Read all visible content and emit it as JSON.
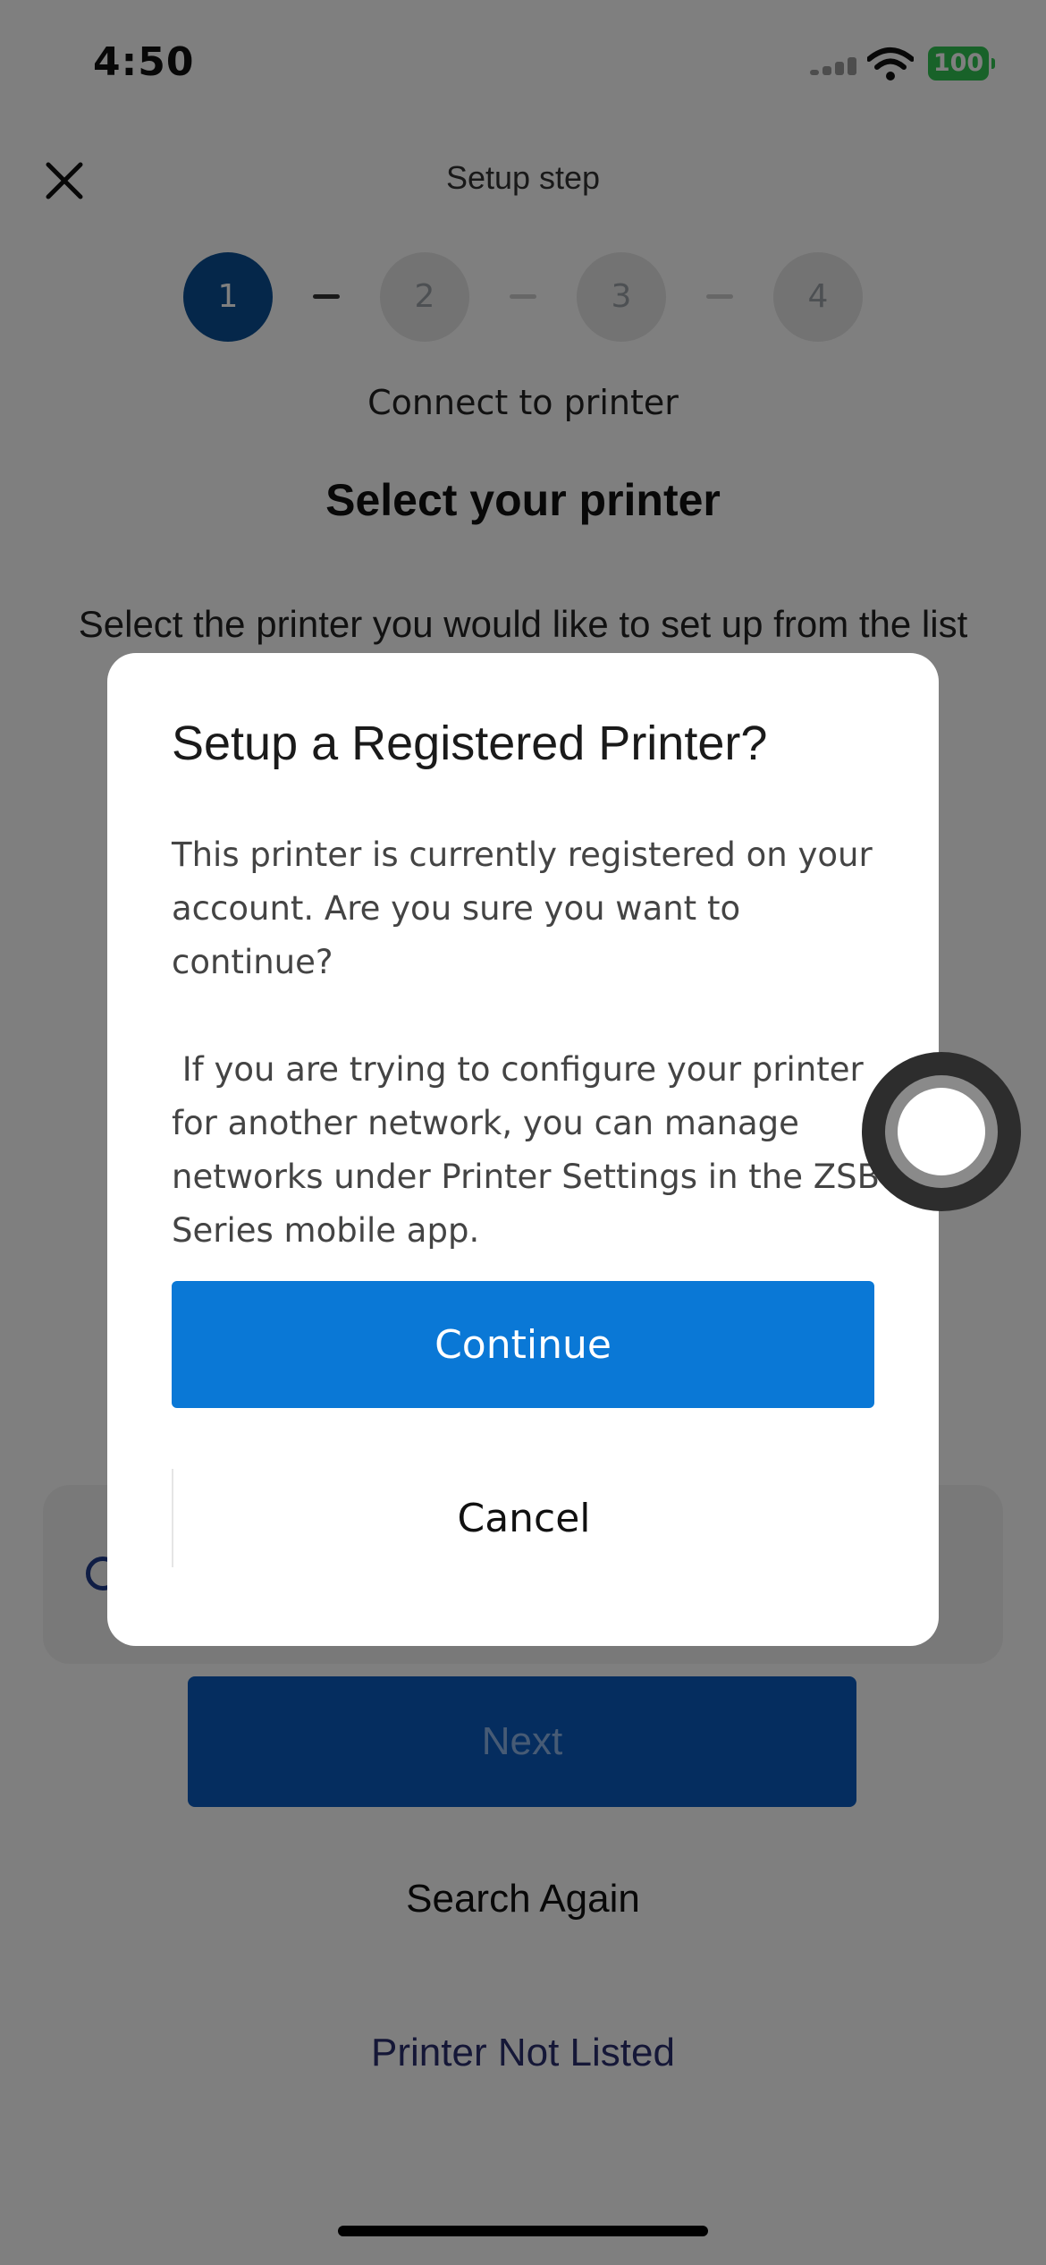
{
  "status_bar": {
    "time": "4:50",
    "battery": "100"
  },
  "header": {
    "title": "Setup step"
  },
  "stepper": {
    "steps": [
      {
        "label": "1",
        "active": true
      },
      {
        "label": "2",
        "active": false
      },
      {
        "label": "3",
        "active": false
      },
      {
        "label": "4",
        "active": false
      }
    ],
    "current_label": "Connect to printer"
  },
  "main": {
    "heading": "Select your printer",
    "instructions": "Select the printer you would like to set up from the list below, then tap Next to continue.",
    "next_label": "Next",
    "search_again_label": "Search Again",
    "not_listed_label": "Printer Not Listed"
  },
  "dialog": {
    "title": "Setup a Registered Printer?",
    "paragraph1": "This printer is currently registered on your account. Are you sure you want to continue?",
    "paragraph2": " If you are trying to configure your printer for another network, you can manage networks under Printer Settings in the ZSB Series mobile app.",
    "continue_label": "Continue",
    "cancel_label": "Cancel"
  },
  "colors": {
    "primary": "#0a78d6",
    "step_active": "#0b4f94",
    "battery": "#31c553"
  }
}
